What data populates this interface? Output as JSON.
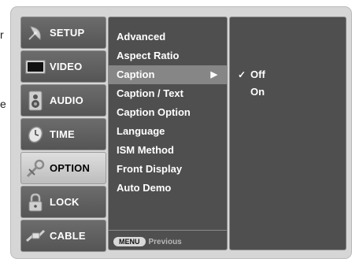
{
  "edge_text": [
    "r",
    "e"
  ],
  "menu": [
    {
      "label": "SETUP",
      "icon": "satellite-dish-icon",
      "selected": false
    },
    {
      "label": "VIDEO",
      "icon": "tv-screen-icon",
      "selected": false
    },
    {
      "label": "AUDIO",
      "icon": "speaker-icon",
      "selected": false
    },
    {
      "label": "TIME",
      "icon": "clock-icon",
      "selected": false
    },
    {
      "label": "OPTION",
      "icon": "tools-icon",
      "selected": true
    },
    {
      "label": "LOCK",
      "icon": "padlock-icon",
      "selected": false
    },
    {
      "label": "CABLE",
      "icon": "cable-plug-icon",
      "selected": false
    }
  ],
  "submenu": {
    "items": [
      {
        "label": "Advanced",
        "highlighted": false
      },
      {
        "label": "Aspect Ratio",
        "highlighted": false
      },
      {
        "label": "Caption",
        "highlighted": true,
        "arrow": "▶"
      },
      {
        "label": "Caption / Text",
        "highlighted": false
      },
      {
        "label": "Caption Option",
        "highlighted": false
      },
      {
        "label": "Language",
        "highlighted": false
      },
      {
        "label": "ISM Method",
        "highlighted": false
      },
      {
        "label": "Front Display",
        "highlighted": false
      },
      {
        "label": "Auto Demo",
        "highlighted": false
      }
    ],
    "footer": {
      "key": "MENU",
      "text": "Previous"
    }
  },
  "options": [
    {
      "label": "Off",
      "checked": true,
      "check_mark": "✓"
    },
    {
      "label": "On",
      "checked": false,
      "check_mark": ""
    }
  ],
  "colors": {
    "panel_bg": "#d6d6d6",
    "menu_button": "#5e5e5e",
    "menu_selected": "#cfcfcf",
    "list_bg": "#4f4f4f",
    "highlight_row": "#868686",
    "text_light": "#ffffff"
  }
}
